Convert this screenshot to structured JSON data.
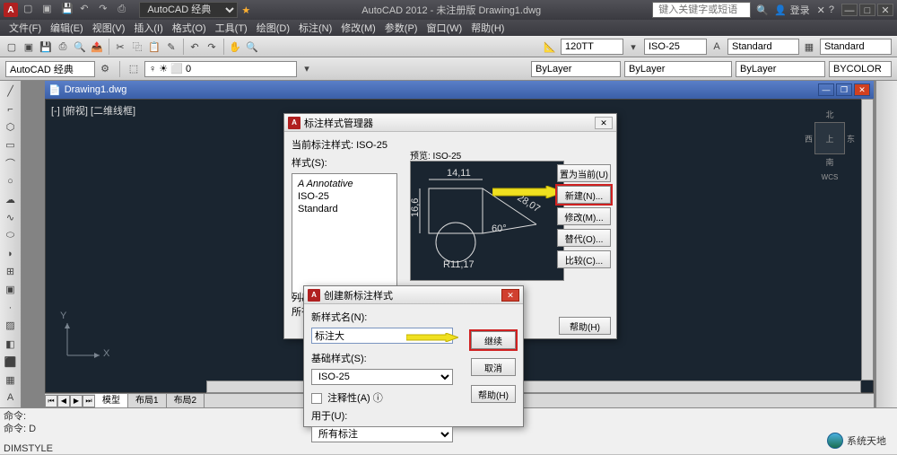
{
  "app": {
    "title_center": "AutoCAD 2012 - 未注册版    Drawing1.dwg",
    "workspace_selector": "AutoCAD 经典",
    "search_placeholder": "键入关键字或短语",
    "login_label": "登录"
  },
  "menu": [
    "文件(F)",
    "编辑(E)",
    "视图(V)",
    "插入(I)",
    "格式(O)",
    "工具(T)",
    "绘图(D)",
    "标注(N)",
    "修改(M)",
    "参数(P)",
    "窗口(W)",
    "帮助(H)"
  ],
  "toolbar2": {
    "workspace": "AutoCAD 经典",
    "dim_style_1": "120TT",
    "dim_style_2": "ISO-25",
    "text_style": "Standard",
    "table_style": "Standard"
  },
  "layers": {
    "current": "ByLayer",
    "linetype": "ByLayer",
    "lineweight": "ByLayer",
    "plotstyle": "BYCOLOR"
  },
  "doc": {
    "title": "Drawing1.dwg",
    "viewport_label": "[-] [俯视] [二维线框]",
    "tabs": [
      "模型",
      "布局1",
      "布局2"
    ],
    "ucs_x": "X",
    "ucs_y": "Y"
  },
  "viewcube": {
    "north": "北",
    "south": "南",
    "east": "东",
    "west": "西",
    "top": "上",
    "wcs": "WCS"
  },
  "dialog1": {
    "title": "标注样式管理器",
    "current_label": "当前标注样式: ISO-25",
    "styles_label": "样式(S):",
    "styles": [
      "Annotative",
      "ISO-25",
      "Standard"
    ],
    "preview_label": "预览: ISO-25",
    "list_label": "列出",
    "all_label": "所有",
    "buttons": {
      "set_current": "置为当前(U)",
      "new": "新建(N)...",
      "modify": "修改(M)...",
      "override": "替代(O)...",
      "compare": "比较(C)..."
    },
    "help": "帮助(H)",
    "preview_dims": {
      "top": "14,11",
      "left": "16,6",
      "right": "28,07",
      "angle": "60°",
      "radius": "R11,17"
    }
  },
  "dialog2": {
    "title": "创建新标注样式",
    "name_label": "新样式名(N):",
    "name_value": "标注大",
    "base_label": "基础样式(S):",
    "base_value": "ISO-25",
    "annotative_label": "注释性(A)",
    "use_label": "用于(U):",
    "use_value": "所有标注",
    "buttons": {
      "continue": "继续",
      "cancel": "取消",
      "help": "帮助(H)"
    }
  },
  "cmd": {
    "line1": "命令:",
    "line2": "命令: D",
    "line3": "DIMSTYLE"
  },
  "watermark": "系统天地"
}
